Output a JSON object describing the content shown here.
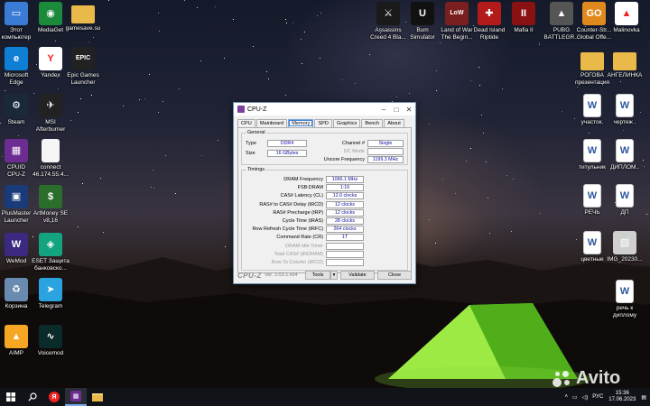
{
  "desktop_icons_left": [
    {
      "label": "Этот\nкомпьютер",
      "icon": "computer-icon",
      "color": "#3a7bd5",
      "glyph": "▭"
    },
    {
      "label": "MediaGet",
      "icon": "mediaget-icon",
      "color": "#1b8a3a",
      "glyph": "◉"
    },
    {
      "label": "gamesave.su",
      "icon": "folder-icon",
      "color": "#e9b949",
      "glyph": ""
    },
    {
      "label": "Microsoft\nEdge",
      "icon": "edge-icon",
      "color": "#0f7fd6",
      "glyph": "e"
    },
    {
      "label": "Yandex",
      "icon": "yandex-icon",
      "color": "#ffffff",
      "glyph": "Y"
    },
    {
      "label": "Epic Games\nLauncher",
      "icon": "epic-games-icon",
      "color": "#222222",
      "glyph": "EPIC"
    },
    {
      "label": "Steam",
      "icon": "steam-icon",
      "color": "#1b2838",
      "glyph": "⚙"
    },
    {
      "label": "MSI\nAfterburner",
      "icon": "msi-afterburner-icon",
      "color": "#222222",
      "glyph": "✈"
    },
    {
      "label": "CPUID\nCPU-Z",
      "icon": "cpuz-icon",
      "color": "#6d2c91",
      "glyph": "▦"
    },
    {
      "label": "connect\n46.174.55.4...",
      "icon": "document-icon",
      "color": "#f5f5f5",
      "glyph": ""
    },
    {
      "label": "PlusMaster\nLauncher",
      "icon": "plusmaster-icon",
      "color": "#1a3b7a",
      "glyph": "▣"
    },
    {
      "label": "ArtMoney SE\nv8.16",
      "icon": "artmoney-icon",
      "color": "#2b6e2b",
      "glyph": "$"
    },
    {
      "label": "WeMod",
      "icon": "wemod-icon",
      "color": "#3b2a80",
      "glyph": "W"
    },
    {
      "label": "ESET Защита\nбанковско...",
      "icon": "eset-icon",
      "color": "#14a37f",
      "glyph": "◈"
    },
    {
      "label": "Корзина",
      "icon": "recycle-bin-icon",
      "color": "#6a8bb0",
      "glyph": "♻"
    },
    {
      "label": "Telegram",
      "icon": "telegram-icon",
      "color": "#2aa3e0",
      "glyph": "➤"
    },
    {
      "label": "AIMP",
      "icon": "aimp-icon",
      "color": "#f5a623",
      "glyph": "▲"
    },
    {
      "label": "Voicemod",
      "icon": "voicemod-icon",
      "color": "#0b2a2a",
      "glyph": "∿"
    }
  ],
  "desktop_icons_top": [
    {
      "label": "Assassins\nCreed 4 Bla...",
      "icon": "assassins-creed-icon",
      "color": "#1a1a1a",
      "glyph": "⚔"
    },
    {
      "label": "Bum\nSimulator",
      "icon": "unreal-icon",
      "color": "#111111",
      "glyph": "U"
    },
    {
      "label": "Land of War\nThe Begin...",
      "icon": "land-of-war-icon",
      "color": "#7a1f1f",
      "glyph": "LoW"
    },
    {
      "label": "Dead Island\nRiptide",
      "icon": "dead-island-icon",
      "color": "#b31b1b",
      "glyph": "✚"
    },
    {
      "label": "Mafia II",
      "icon": "mafia-icon",
      "color": "#8a1111",
      "glyph": "II"
    },
    {
      "label": "PUBG\nBATTLEGR...",
      "icon": "pubg-icon",
      "color": "#555555",
      "glyph": "▲"
    },
    {
      "label": "Counter-Str...\nGlobal Offe...",
      "icon": "csgo-icon",
      "color": "#e08a1e",
      "glyph": "GO"
    },
    {
      "label": "Malinovka",
      "icon": "malinovka-icon",
      "color": "#ffffff",
      "glyph": "▲"
    }
  ],
  "desktop_icons_right": [
    {
      "label": "РОГОВА\nпрезентация",
      "icon": "folder-icon",
      "color": "#e9b949",
      "glyph": ""
    },
    {
      "label": "АНГЕЛИНКА",
      "icon": "folder-icon",
      "color": "#e9b949",
      "glyph": ""
    },
    {
      "label": "участок.",
      "icon": "word-doc-icon",
      "color": "#2b579a",
      "glyph": "W"
    },
    {
      "label": "чертеж .",
      "icon": "word-doc-icon",
      "color": "#2b579a",
      "glyph": "W"
    },
    {
      "label": "титульник",
      "icon": "word-doc-icon",
      "color": "#2b579a",
      "glyph": "W"
    },
    {
      "label": "ДИПЛОМ..",
      "icon": "word-doc-icon",
      "color": "#2b579a",
      "glyph": "W"
    },
    {
      "label": "РЕЧЬ",
      "icon": "word-doc-icon",
      "color": "#2b579a",
      "glyph": "W"
    },
    {
      "label": "ДП",
      "icon": "word-doc-icon",
      "color": "#2b579a",
      "glyph": "W"
    },
    {
      "label": "цветные",
      "icon": "word-doc-icon",
      "color": "#2b579a",
      "glyph": "W"
    },
    {
      "label": "IMG_20230...",
      "icon": "image-file-icon",
      "color": "#cfcfcf",
      "glyph": "▨"
    },
    {
      "label": "речь к\nдиплому",
      "icon": "word-doc-icon",
      "color": "#2b579a",
      "glyph": "W"
    }
  ],
  "window": {
    "title": "CPU-Z",
    "tabs": [
      "CPU",
      "Mainboard",
      "Memory",
      "SPD",
      "Graphics",
      "Bench",
      "About"
    ],
    "active_tab": "Memory",
    "general": {
      "title": "General",
      "type_label": "Type",
      "type_value": "DDR4",
      "size_label": "Size",
      "size_value": "16 GBytes",
      "channel_label": "Channel #",
      "channel_value": "Single",
      "dc_mode_label": "DC Mode",
      "dc_mode_value": "",
      "uncore_label": "Uncore Frequency",
      "uncore_value": "1199.3 MHz"
    },
    "timings": {
      "title": "Timings",
      "rows": [
        {
          "label": "DRAM Frequency",
          "value": "1066.1 MHz",
          "enabled": true
        },
        {
          "label": "FSB:DRAM",
          "value": "1:16",
          "enabled": true
        },
        {
          "label": "CAS# Latency (CL)",
          "value": "12.0 clocks",
          "enabled": true
        },
        {
          "label": "RAS# to CAS# Delay (tRCD)",
          "value": "12 clocks",
          "enabled": true
        },
        {
          "label": "RAS# Precharge (tRP)",
          "value": "12 clocks",
          "enabled": true
        },
        {
          "label": "Cycle Time (tRAS)",
          "value": "28 clocks",
          "enabled": true
        },
        {
          "label": "Row Refresh Cycle Time (tRFC)",
          "value": "264 clocks",
          "enabled": true
        },
        {
          "label": "Command Rate (CR)",
          "value": "1T",
          "enabled": true
        },
        {
          "label": "DRAM Idle Timer",
          "value": "",
          "enabled": false
        },
        {
          "label": "Total CAS# (tRDRAM)",
          "value": "",
          "enabled": false
        },
        {
          "label": "Row To Column (tRCD)",
          "value": "",
          "enabled": false
        }
      ]
    },
    "footer": {
      "logo": "CPU-Z",
      "version": "Ver. 2.03.1.x64",
      "tools_label": "Tools",
      "validate_label": "Validate",
      "close_label": "Close"
    }
  },
  "taskbar": {
    "language": "РУС",
    "time": "15:36",
    "date": "17.06.2023"
  },
  "watermark": "Avito"
}
